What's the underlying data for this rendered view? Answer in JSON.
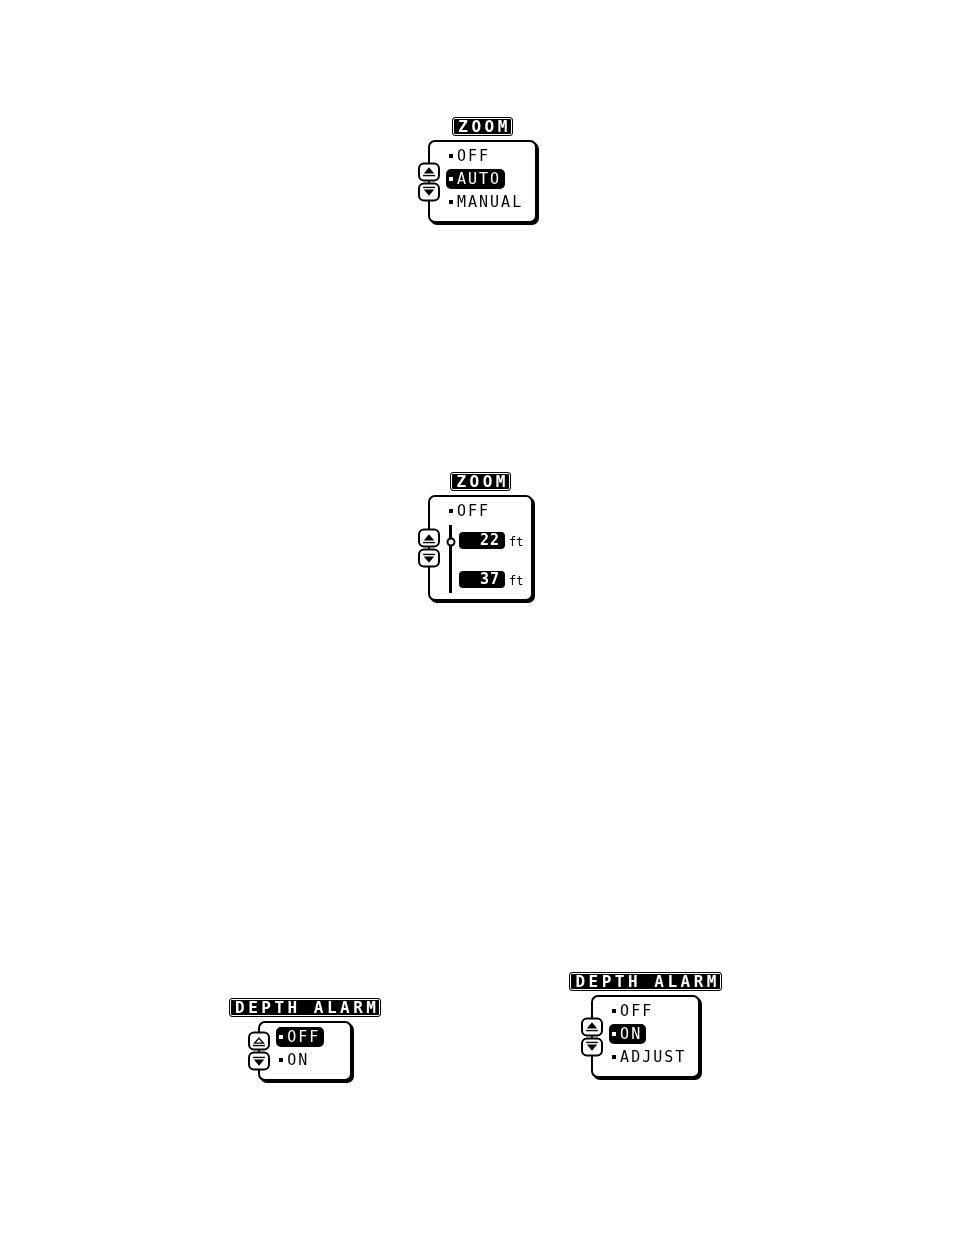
{
  "menus": [
    {
      "kind": "list",
      "title": "ZOOM",
      "up_disabled": false,
      "options": [
        {
          "label": "OFF",
          "selected": false
        },
        {
          "label": "AUTO",
          "selected": true
        },
        {
          "label": "MANUAL",
          "selected": false
        }
      ]
    },
    {
      "kind": "range",
      "title": "ZOOM",
      "up_disabled": false,
      "options": [
        {
          "label": "OFF",
          "selected": false
        }
      ],
      "range": {
        "level": 0.75,
        "fields": [
          {
            "value": "22",
            "unit": "ft"
          },
          {
            "value": "37",
            "unit": "ft"
          }
        ]
      }
    },
    {
      "kind": "list",
      "title": "DEPTH ALARM",
      "up_disabled": true,
      "options": [
        {
          "label": "OFF",
          "selected": true
        },
        {
          "label": "ON",
          "selected": false
        }
      ]
    },
    {
      "kind": "list",
      "title": "DEPTH ALARM",
      "up_disabled": false,
      "options": [
        {
          "label": "OFF",
          "selected": false
        },
        {
          "label": "ON",
          "selected": true
        },
        {
          "label": "ADJUST",
          "selected": false
        }
      ]
    }
  ]
}
